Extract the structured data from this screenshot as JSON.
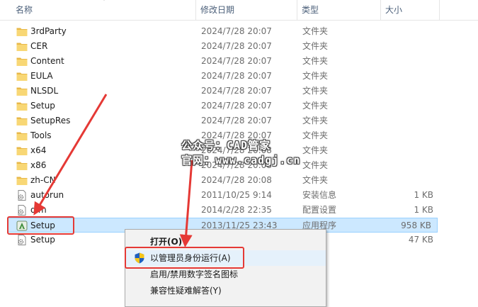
{
  "columns": {
    "name": "名称",
    "modified": "修改日期",
    "type": "类型",
    "size": "大小"
  },
  "files": [
    {
      "name": "3rdParty",
      "date": "2024/7/28 20:07",
      "type": "文件夹",
      "size": "",
      "icon": "folder-icon"
    },
    {
      "name": "CER",
      "date": "2024/7/28 20:07",
      "type": "文件夹",
      "size": "",
      "icon": "folder-icon"
    },
    {
      "name": "Content",
      "date": "2024/7/28 20:07",
      "type": "文件夹",
      "size": "",
      "icon": "folder-icon"
    },
    {
      "name": "EULA",
      "date": "2024/7/28 20:07",
      "type": "文件夹",
      "size": "",
      "icon": "folder-icon"
    },
    {
      "name": "NLSDL",
      "date": "2024/7/28 20:07",
      "type": "文件夹",
      "size": "",
      "icon": "folder-icon"
    },
    {
      "name": "Setup",
      "date": "2024/7/28 20:07",
      "type": "文件夹",
      "size": "",
      "icon": "folder-icon"
    },
    {
      "name": "SetupRes",
      "date": "2024/7/28 20:07",
      "type": "文件夹",
      "size": "",
      "icon": "folder-icon"
    },
    {
      "name": "Tools",
      "date": "2024/7/28 20:07",
      "type": "文件夹",
      "size": "",
      "icon": "folder-icon"
    },
    {
      "name": "x64",
      "date": "2024/7/28 20:08",
      "type": "文件夹",
      "size": "",
      "icon": "folder-icon"
    },
    {
      "name": "x86",
      "date": "2024/7/28 20:08",
      "type": "文件夹",
      "size": "",
      "icon": "folder-icon"
    },
    {
      "name": "zh-CN",
      "date": "2024/7/28 20:08",
      "type": "文件夹",
      "size": "",
      "icon": "folder-icon"
    },
    {
      "name": "autorun",
      "date": "2011/10/25 9:14",
      "type": "安装信息",
      "size": "1 KB",
      "icon": "settings-file-icon"
    },
    {
      "name": "dlm",
      "date": "2014/2/28 22:35",
      "type": "配置设置",
      "size": "1 KB",
      "icon": "settings-file-icon"
    },
    {
      "name": "Setup",
      "date": "2013/11/25 23:43",
      "type": "应用程序",
      "size": "958 KB",
      "icon": "setup-app-icon",
      "selected": true
    },
    {
      "name": "Setup",
      "date": "",
      "type": "",
      "size": "47 KB",
      "icon": "settings-file-icon"
    }
  ],
  "context_menu": {
    "items": [
      {
        "label": "打开(O)",
        "bold": true
      },
      {
        "label": "以管理员身份运行(A)",
        "icon": "uac-shield-icon"
      },
      {
        "label": "启用/禁用数字签名图标"
      },
      {
        "label": "兼容性疑难解答(Y)"
      }
    ]
  },
  "watermark": {
    "line1": "公众号：CAD管家",
    "line2": "官网：www.cadgj.cn"
  },
  "colors": {
    "selection": "#cce8ff",
    "selection_border": "#99d1ff",
    "highlight_box": "#e53935",
    "folder": "#f8d775"
  }
}
